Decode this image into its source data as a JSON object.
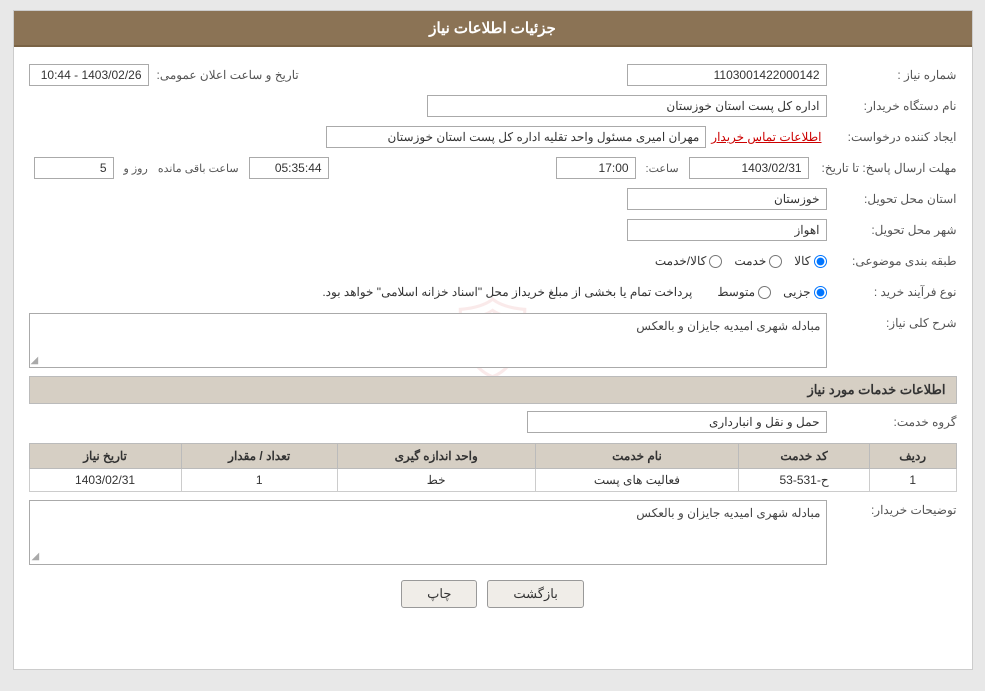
{
  "page": {
    "title": "جزئیات اطلاعات نیاز"
  },
  "header": {
    "title": "جزئیات اطلاعات نیاز"
  },
  "fields": {
    "need_number_label": "شماره نیاز :",
    "need_number_value": "1103001422000142",
    "buyer_name_label": "نام دستگاه خریدار:",
    "buyer_name_value": "اداره کل پست استان خوزستان",
    "creator_label": "ایجاد کننده درخواست:",
    "creator_name": "مهران امیری مسئول واحد تقلیه اداره کل پست استان خوزستان",
    "creator_contact_link": "اطلاعات تماس خریدار",
    "deadline_label": "مهلت ارسال پاسخ: تا تاریخ:",
    "deadline_date": "1403/02/31",
    "deadline_time_label": "ساعت:",
    "deadline_time": "17:00",
    "deadline_days_label": "روز و",
    "deadline_days": "5",
    "deadline_remaining_label": "ساعت باقی مانده",
    "deadline_remaining": "05:35:44",
    "province_label": "استان محل تحویل:",
    "province_value": "خوزستان",
    "city_label": "شهر محل تحویل:",
    "city_value": "اهواز",
    "category_label": "طبقه بندی موضوعی:",
    "category_options": [
      "کالا",
      "خدمت",
      "کالا/خدمت"
    ],
    "category_selected": "کالا",
    "process_label": "نوع فرآیند خرید :",
    "process_options": [
      "جزیی",
      "متوسط"
    ],
    "process_selected": "متوسط",
    "process_note": "پرداخت تمام یا بخشی از مبلغ خریداز محل \"اسناد خزانه اسلامی\" خواهد بود.",
    "need_desc_label": "شرح کلی نیاز:",
    "need_desc_value": "مبادله شهری امیدیه جایزان و بالعکس",
    "services_section_title": "اطلاعات خدمات مورد نیاز",
    "service_group_label": "گروه خدمت:",
    "service_group_value": "حمل و نقل و انبارداری",
    "table": {
      "columns": [
        "ردیف",
        "کد خدمت",
        "نام خدمت",
        "واحد اندازه گیری",
        "تعداد / مقدار",
        "تاریخ نیاز"
      ],
      "rows": [
        {
          "row": "1",
          "code": "ح-531-53",
          "name": "فعالیت های پست",
          "unit": "خط",
          "quantity": "1",
          "date": "1403/02/31"
        }
      ]
    },
    "buyer_desc_label": "توضیحات خریدار:",
    "buyer_desc_value": "مبادله شهری امیدیه جایزان و بالعکس"
  },
  "buttons": {
    "print": "چاپ",
    "back": "بازگشت"
  },
  "announce_datetime_label": "تاریخ و ساعت اعلان عمومی:",
  "announce_datetime_value": "1403/02/26 - 10:44"
}
